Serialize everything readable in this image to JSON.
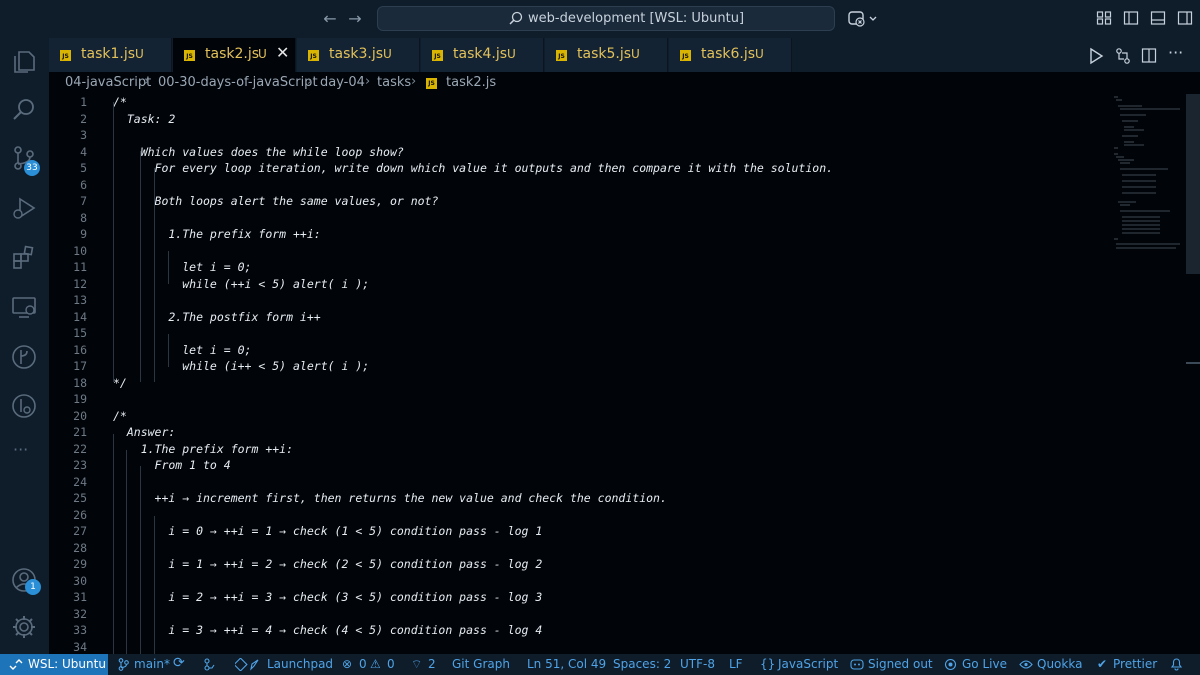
{
  "titlebar": {
    "title": "web-development [WSL: Ubuntu]"
  },
  "activity": {
    "source_control_badge": "33",
    "accounts_badge": "1",
    "more": "···"
  },
  "tabs": [
    {
      "name": "task1.js",
      "status": "U",
      "active": false
    },
    {
      "name": "task2.js",
      "status": "U",
      "active": true
    },
    {
      "name": "task3.js",
      "status": "U",
      "active": false
    },
    {
      "name": "task4.js",
      "status": "U",
      "active": false
    },
    {
      "name": "task5.js",
      "status": "U",
      "active": false
    },
    {
      "name": "task6.js",
      "status": "U",
      "active": false
    }
  ],
  "js_icon_text": "JS",
  "breadcrumb": [
    "04-javaScript",
    "00-30-days-of-javaScript",
    "day-04",
    "tasks",
    "task2.js"
  ],
  "code_lines": [
    "/*",
    "  Task: 2",
    "",
    "    Which values does the while loop show?",
    "      For every loop iteration, write down which value it outputs and then compare it with the solution.",
    "",
    "      Both loops alert the same values, or not?",
    "",
    "        1.The prefix form ++i:",
    "",
    "          let i = 0;",
    "          while (++i < 5) alert( i );",
    "",
    "        2.The postfix form i++",
    "",
    "          let i = 0;",
    "          while (i++ < 5) alert( i );",
    "*/",
    "",
    "/*",
    "  Answer:",
    "    1.The prefix form ++i:",
    "      From 1 to 4",
    "",
    "      ++i → increment first, then returns the new value and check the condition.",
    "",
    "        i = 0 → ++i = 1 → check (1 < 5) condition pass - log 1",
    "",
    "        i = 1 → ++i = 2 → check (2 < 5) condition pass - log 2",
    "",
    "        i = 2 → ++i = 3 → check (3 < 5) condition pass - log 3",
    "",
    "        i = 3 → ++i = 4 → check (4 < 5) condition pass - log 4",
    ""
  ],
  "status": {
    "remote": "WSL: Ubuntu",
    "branch": "main*",
    "launchpad": "Launchpad",
    "errors": "0",
    "warnings": "0",
    "ports": "2",
    "git_graph": "Git Graph",
    "cursor": "Ln 51, Col 49",
    "spaces": "Spaces: 2",
    "encoding": "UTF-8",
    "eol": "LF",
    "language": "JavaScript",
    "signed": "Signed out",
    "golive": "Go Live",
    "quokka": "Quokka",
    "prettier": "Prettier"
  },
  "colors": {
    "editor_bg": "#010409",
    "chrome_bg": "#0f1d2b",
    "tab_modified": "#e3c15a",
    "status_text": "#4fa3e6",
    "remote_bg": "#1e74b8"
  }
}
